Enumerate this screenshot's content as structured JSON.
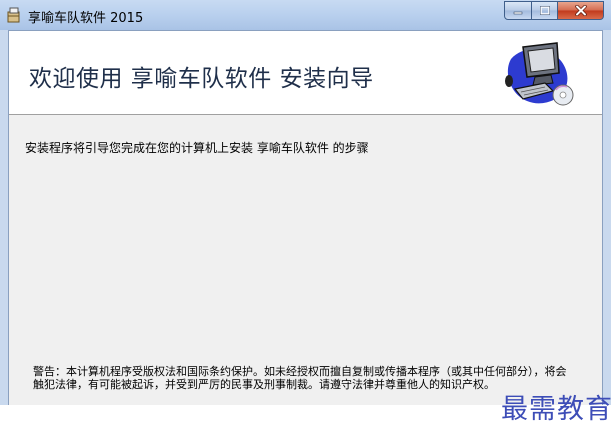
{
  "window": {
    "title": "享喻车队软件 2015"
  },
  "banner": {
    "title": "欢迎使用 享喻车队软件 安装向导"
  },
  "intro_text": "安装程序将引导您完成在您的计算机上安装 享喻车队软件 的步骤",
  "warning_text": "警告：本计算机程序受版权法和国际条约保护。如未经授权而擅自复制或传播本程序（或其中任何部分），将会触犯法律，有可能被起诉，并受到严厉的民事及刑事制裁。请遵守法律并尊重他人的知识产权。",
  "watermark": "最需教育",
  "icons": {
    "app": "installer-icon",
    "banner": "computer-cd-icon",
    "minimize": "minimize-icon",
    "maximize": "maximize-icon",
    "close": "close-icon"
  },
  "colors": {
    "titlebar": "#b9d0ee",
    "close_button": "#c1391c",
    "watermark": "#3d4db7"
  }
}
